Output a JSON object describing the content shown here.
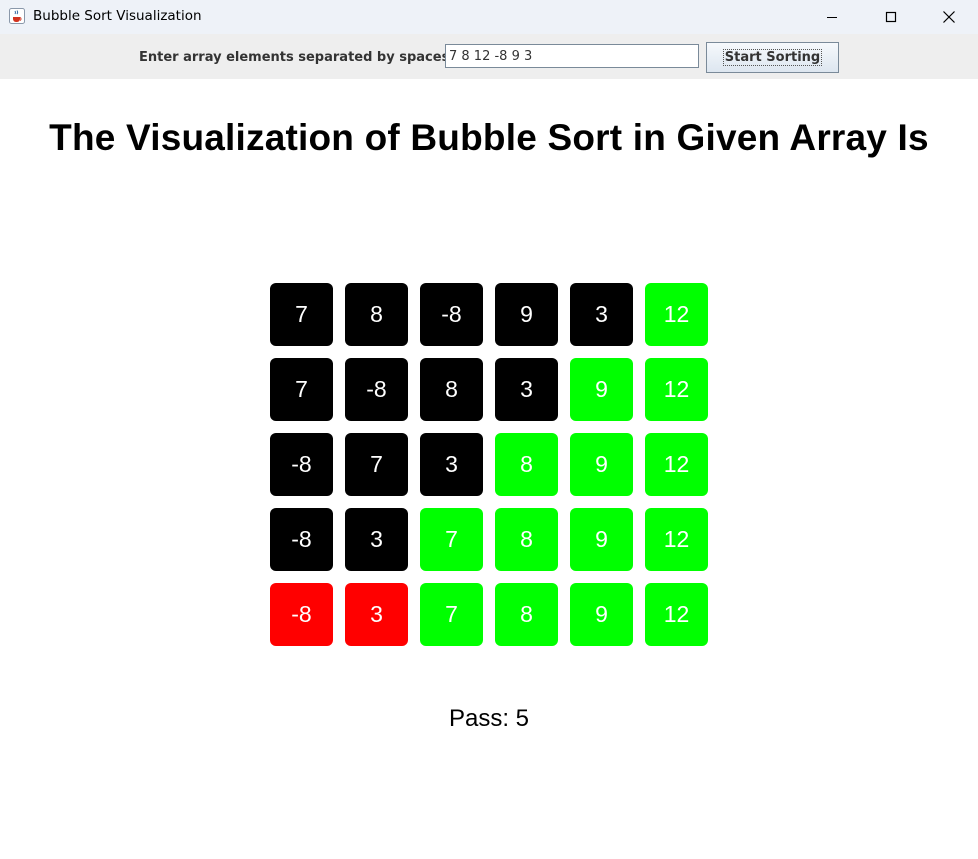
{
  "window": {
    "title": "Bubble Sort Visualization",
    "icon": "java-cup-icon"
  },
  "toolbar": {
    "prompt_label": "Enter array elements separated by spaces:",
    "input_value": "7 8 12 -8 9 3",
    "start_label": "Start Sorting"
  },
  "heading": "The Visualization of Bubble Sort in Given Array Is",
  "colors": {
    "unsorted": "#000000",
    "sorted": "#00ff00",
    "final_compare": "#ff0000"
  },
  "passes": [
    {
      "values": [
        "7",
        "8",
        "-8",
        "9",
        "3",
        "12"
      ],
      "states": [
        "unsorted",
        "unsorted",
        "unsorted",
        "unsorted",
        "unsorted",
        "sorted"
      ]
    },
    {
      "values": [
        "7",
        "-8",
        "8",
        "3",
        "9",
        "12"
      ],
      "states": [
        "unsorted",
        "unsorted",
        "unsorted",
        "unsorted",
        "sorted",
        "sorted"
      ]
    },
    {
      "values": [
        "-8",
        "7",
        "3",
        "8",
        "9",
        "12"
      ],
      "states": [
        "unsorted",
        "unsorted",
        "unsorted",
        "sorted",
        "sorted",
        "sorted"
      ]
    },
    {
      "values": [
        "-8",
        "3",
        "7",
        "8",
        "9",
        "12"
      ],
      "states": [
        "unsorted",
        "unsorted",
        "sorted",
        "sorted",
        "sorted",
        "sorted"
      ]
    },
    {
      "values": [
        "-8",
        "3",
        "7",
        "8",
        "9",
        "12"
      ],
      "states": [
        "final_compare",
        "final_compare",
        "sorted",
        "sorted",
        "sorted",
        "sorted"
      ]
    }
  ],
  "pass_label": "Pass: 5"
}
